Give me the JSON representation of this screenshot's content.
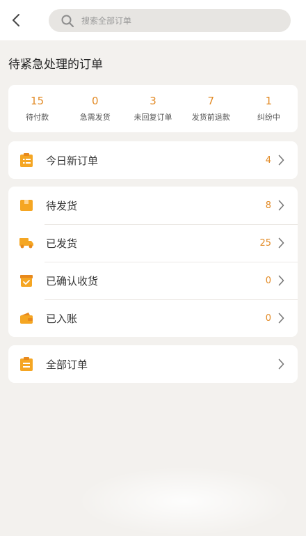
{
  "search": {
    "placeholder": "搜索全部订单"
  },
  "section_title": "待紧急处理的订单",
  "stats": [
    {
      "value": "15",
      "label": "待付款"
    },
    {
      "value": "0",
      "label": "急需发货"
    },
    {
      "value": "3",
      "label": "未回复订单"
    },
    {
      "value": "7",
      "label": "发货前退款"
    },
    {
      "value": "1",
      "label": "纠纷中"
    }
  ],
  "today": {
    "label": "今日新订单",
    "count": "4",
    "icon": "clipboard-list-icon"
  },
  "order_groups": [
    {
      "label": "待发货",
      "count": "8",
      "icon": "box-icon"
    },
    {
      "label": "已发货",
      "count": "25",
      "icon": "truck-icon"
    },
    {
      "label": "已确认收货",
      "count": "0",
      "icon": "check-box-icon"
    },
    {
      "label": "已入账",
      "count": "0",
      "icon": "wallet-icon"
    }
  ],
  "all_orders": {
    "label": "全部订单",
    "icon": "clipboard-icon"
  },
  "colors": {
    "accent": "#e28a25",
    "icon_orange": "#f5a623",
    "background": "#f3f1ee"
  }
}
